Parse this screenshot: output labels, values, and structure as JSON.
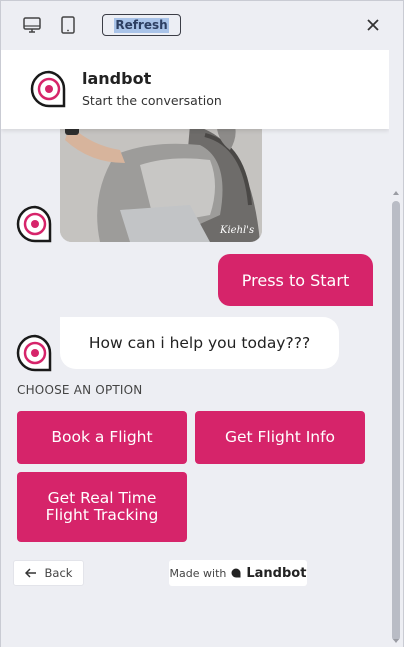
{
  "toolbar": {
    "refresh_label": "Refresh",
    "icons": [
      "desktop-icon",
      "tablet-icon",
      "close-icon"
    ]
  },
  "header": {
    "title": "landbot",
    "subtitle": "Start the conversation"
  },
  "messages": {
    "photo_watermark": "Kiehl's",
    "user_reply": "Press to Start",
    "bot_question": "How can i help you today???"
  },
  "options": {
    "label": "CHOOSE AN OPTION",
    "items": [
      "Book a Flight",
      "Get Flight Info",
      "Get Real Time Flight Tracking"
    ]
  },
  "footer": {
    "back_label": "Back",
    "made_with_label": "Made with",
    "brand": "Landbot"
  },
  "colors": {
    "accent": "#d6246a",
    "background": "#edeef3",
    "header_bg": "#ffffff"
  }
}
